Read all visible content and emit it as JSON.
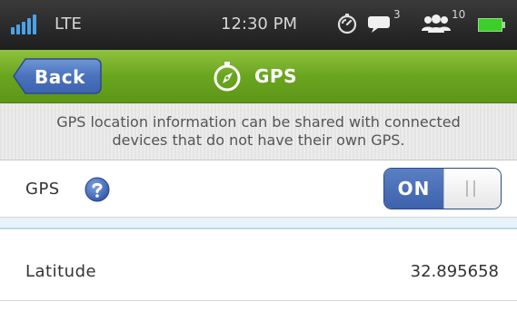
{
  "status_bar": {
    "network": "LTE",
    "time": "12:30 PM",
    "message_count": "3",
    "connected_count": "10",
    "icons": {
      "signal": "signal-bars-icon",
      "stopwatch": "stopwatch-icon",
      "message": "message-bubble-icon",
      "people": "people-group-icon",
      "battery": "battery-icon"
    }
  },
  "nav": {
    "back_label": "Back",
    "title": "GPS",
    "title_icon": "compass-icon"
  },
  "info": {
    "text_line1": "GPS location information can be shared with connected",
    "text_line2": "devices that do not have their own GPS."
  },
  "gps_setting": {
    "label": "GPS",
    "help_icon": "help-icon",
    "toggle_state": "ON"
  },
  "location": {
    "latitude_label": "Latitude",
    "latitude_value": "32.895658"
  },
  "colors": {
    "nav_green": "#6aa51f",
    "toggle_blue": "#3d62ad",
    "signal_blue": "#4aa3e8",
    "battery_green": "#3ccf2a",
    "title_text": "#ffffff"
  }
}
